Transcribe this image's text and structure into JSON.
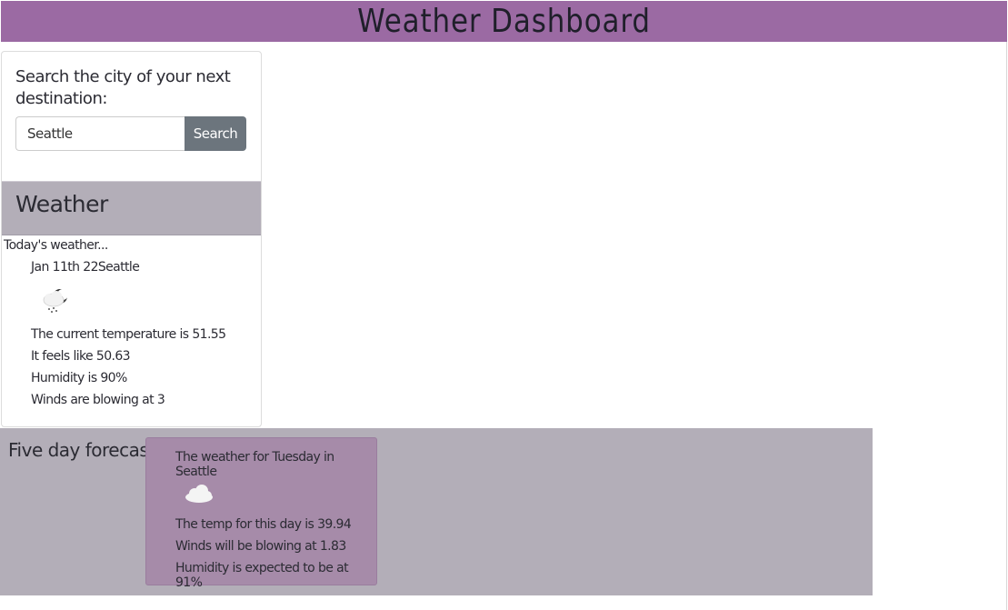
{
  "header": {
    "title": "Weather Dashboard"
  },
  "search": {
    "prompt": "Search the city of your next destination:",
    "input_value": "Seattle",
    "button_label": "Search"
  },
  "weather": {
    "heading": "Weather",
    "today_label": "Today's weather...",
    "date_city": "Jan 11th 22Seattle",
    "icon": "rain-cloud-moon-icon",
    "temperature_line": "The current temperature is 51.55",
    "feels_line": "It feels like 50.63",
    "humidity_line": "Humidity is 90%",
    "wind_line": "Winds are blowing at 3"
  },
  "forecast": {
    "title": "Five day forecast:",
    "cards": [
      {
        "heading": "The weather for Tuesday in Seattle",
        "icon": "cloud-icon",
        "temp_line": "The temp for this day is 39.94",
        "wind_line": "Winds will be blowing at 1.83",
        "humidity_line": "Humidity is expected to be at 91%"
      }
    ]
  },
  "colors": {
    "header_bg": "#9b6aa3",
    "panel_bg": "#b3aeb8",
    "forecast_card_bg": "#a68ba9",
    "search_button_bg": "#6c757d"
  }
}
